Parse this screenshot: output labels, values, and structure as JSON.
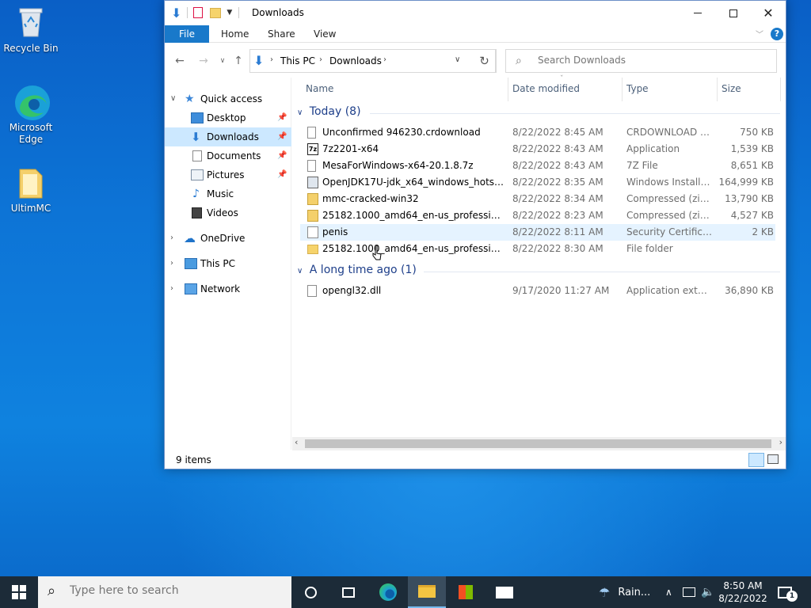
{
  "desktop": {
    "icons": [
      {
        "label": "Recycle Bin"
      },
      {
        "label": "Microsoft Edge"
      },
      {
        "label": "UltimMC"
      }
    ]
  },
  "window": {
    "title": "Downloads",
    "ribbon_tabs": [
      "File",
      "Home",
      "Share",
      "View"
    ],
    "address": {
      "segments": [
        "This PC",
        "Downloads"
      ]
    },
    "search_placeholder": "Search Downloads",
    "nav": {
      "quick_access": "Quick access",
      "items": [
        "Desktop",
        "Downloads",
        "Documents",
        "Pictures",
        "Music",
        "Videos"
      ],
      "onedrive": "OneDrive",
      "this_pc": "This PC",
      "network": "Network"
    },
    "columns": {
      "name": "Name",
      "date": "Date modified",
      "type": "Type",
      "size": "Size"
    },
    "groups": [
      {
        "label": "Today (8)",
        "files": [
          {
            "name": "Unconfirmed 946230.crdownload",
            "date": "8/22/2022 8:45 AM",
            "type": "CRDOWNLOAD File",
            "size": "750 KB",
            "icon": "blank-file-icon"
          },
          {
            "name": "7z2201-x64",
            "date": "8/22/2022 8:43 AM",
            "type": "Application",
            "size": "1,539 KB",
            "icon": "7zip-app-icon"
          },
          {
            "name": "MesaForWindows-x64-20.1.8.7z",
            "date": "8/22/2022 8:43 AM",
            "type": "7Z File",
            "size": "8,651 KB",
            "icon": "blank-file-icon"
          },
          {
            "name": "OpenJDK17U-jdk_x64_windows_hotspot_...",
            "date": "8/22/2022 8:35 AM",
            "type": "Windows Installer ...",
            "size": "164,999 KB",
            "icon": "installer-icon"
          },
          {
            "name": "mmc-cracked-win32",
            "date": "8/22/2022 8:34 AM",
            "type": "Compressed (zipp...",
            "size": "13,790 KB",
            "icon": "zip-folder-icon"
          },
          {
            "name": "25182.1000_amd64_en-us_professional_5...",
            "date": "8/22/2022 8:23 AM",
            "type": "Compressed (zipp...",
            "size": "4,527 KB",
            "icon": "zip-folder-icon"
          },
          {
            "name": "penis",
            "date": "8/22/2022 8:11 AM",
            "type": "Security Certificate",
            "size": "2 KB",
            "icon": "certificate-icon"
          },
          {
            "name": "25182.1000_amd64_en-us_professional_5...",
            "date": "8/22/2022 8:30 AM",
            "type": "File folder",
            "size": "",
            "icon": "folder-icon"
          }
        ]
      },
      {
        "label": "A long time ago (1)",
        "files": [
          {
            "name": "opengl32.dll",
            "date": "9/17/2020 11:27 AM",
            "type": "Application exten...",
            "size": "36,890 KB",
            "icon": "dll-file-icon"
          }
        ]
      }
    ],
    "status": "9 items"
  },
  "taskbar": {
    "search_placeholder": "Type here to search",
    "weather": "Rain...",
    "time": "8:50 AM",
    "date": "8/22/2022",
    "notification_count": "1"
  }
}
